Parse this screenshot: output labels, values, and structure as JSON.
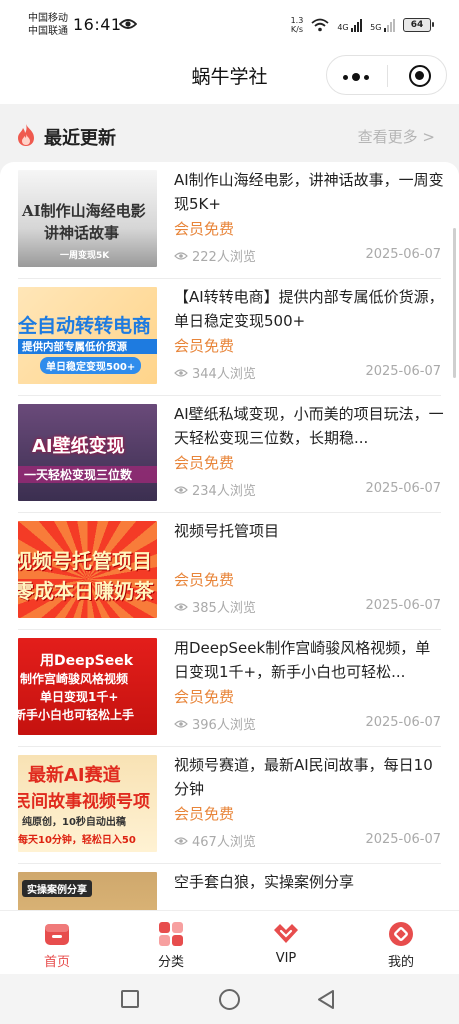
{
  "status_bar": {
    "carrier_1": "中国移动",
    "carrier_2": "中国联通",
    "time": "16:41",
    "net_speed_value": "1.3",
    "net_speed_unit": "K/s",
    "sim1_label": "4G",
    "sim2_label": "5G",
    "battery": "64"
  },
  "header": {
    "title": "蜗牛学社",
    "more_icon": "more-dots-icon",
    "close_icon": "target-circle-icon"
  },
  "section": {
    "title": "最近更新",
    "see_more": "查看更多 >",
    "icon": "fire-icon"
  },
  "items": [
    {
      "title": "AI制作山海经电影，讲神话故事，一周变现5K+",
      "badge": "会员免费",
      "views": "222人浏览",
      "date": "2025-06-07",
      "thumb_lines": [
        "AI制作山海经电影",
        "讲神话故事",
        "一周变现5K"
      ]
    },
    {
      "title": "【AI转转电商】提供内部专属低价货源，单日稳定变现500+",
      "badge": "会员免费",
      "views": "344人浏览",
      "date": "2025-06-07",
      "thumb_lines": [
        "全自动转转电商",
        "提供内部专属低价货源",
        "单日稳定变现500+"
      ]
    },
    {
      "title": "AI壁纸私域变现，小而美的项目玩法，一天轻松变现三位数，长期稳...",
      "badge": "会员免费",
      "views": "234人浏览",
      "date": "2025-06-07",
      "thumb_lines": [
        "AI壁纸变现",
        "一天轻松变现三位数"
      ]
    },
    {
      "title": "视频号托管项目",
      "badge": "会员免费",
      "views": "385人浏览",
      "date": "2025-06-07",
      "thumb_lines": [
        "视频号托管项目",
        "零成本日赚奶茶"
      ]
    },
    {
      "title": "用DeepSeek制作宫崎骏风格视频，单日变现1千+，新手小白也可轻松...",
      "badge": "会员免费",
      "views": "396人浏览",
      "date": "2025-06-07",
      "thumb_lines": [
        "用DeepSeek",
        "制作宫崎骏风格视频",
        "单日变现1千+",
        "新手小白也可轻松上手"
      ]
    },
    {
      "title": "视频号赛道，最新AI民间故事，每日10分钟",
      "badge": "会员免费",
      "views": "467人浏览",
      "date": "2025-06-07",
      "thumb_lines": [
        "最新AI赛道",
        "民间故事视频号项",
        "纯原创，10秒自动出稿",
        "每天10分钟，轻松日入50"
      ]
    },
    {
      "title": "空手套白狼，实操案例分享",
      "thumb_lines": [
        "实操案例分享"
      ]
    }
  ],
  "tabbar": {
    "tabs": [
      {
        "label": "首页",
        "icon": "home-icon",
        "active": true
      },
      {
        "label": "分类",
        "icon": "category-grid-icon",
        "active": false
      },
      {
        "label": "VIP",
        "icon": "vip-heart-icon",
        "active": false
      },
      {
        "label": "我的",
        "icon": "profile-icon",
        "active": false
      }
    ]
  },
  "colors": {
    "accent": "#e74d4d",
    "badge": "#e8853a",
    "muted": "#aaaaaa"
  }
}
